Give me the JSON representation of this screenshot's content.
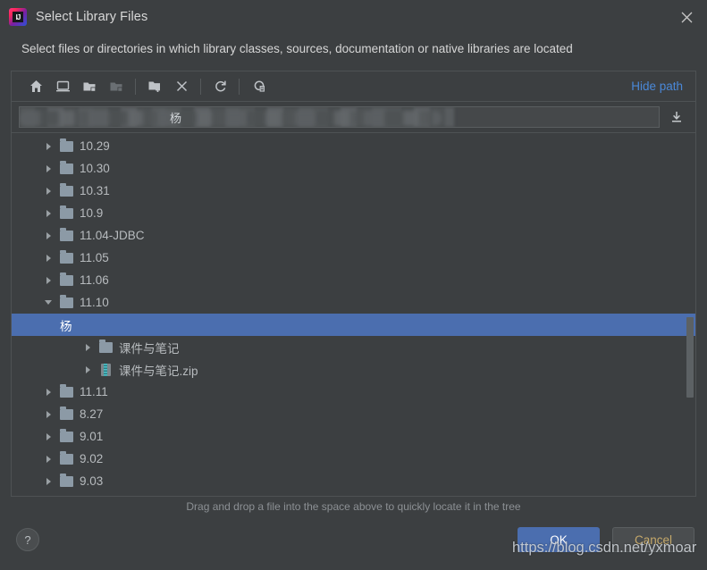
{
  "window": {
    "title": "Select Library Files",
    "app_icon": "intellij-idea-icon",
    "close_label": "✕"
  },
  "subtitle": "Select files or directories in which library classes, sources, documentation or native libraries are located",
  "toolbar": {
    "items": [
      {
        "name": "home-icon",
        "title": "Home"
      },
      {
        "name": "desktop-icon",
        "title": "Desktop"
      },
      {
        "name": "expand-folder-icon",
        "title": "Expand All"
      },
      {
        "name": "collapse-folder-icon",
        "title": "Collapse All"
      },
      {
        "name": "new-folder-icon",
        "title": "New Folder"
      },
      {
        "name": "delete-icon",
        "title": "Delete"
      },
      {
        "name": "refresh-icon",
        "title": "Refresh"
      },
      {
        "name": "show-hidden-files-icon",
        "title": "Show Hidden Files"
      }
    ],
    "hide_path_label": "Hide path"
  },
  "path_field": {
    "value": "杨",
    "placeholder": "",
    "redacted": true,
    "download_icon": "download-icon"
  },
  "tree": {
    "rows": [
      {
        "label": "10.29",
        "depth": 1,
        "icon": "folder-icon",
        "expanded": false,
        "selected": false
      },
      {
        "label": "10.30",
        "depth": 1,
        "icon": "folder-icon",
        "expanded": false,
        "selected": false
      },
      {
        "label": "10.31",
        "depth": 1,
        "icon": "folder-icon",
        "expanded": false,
        "selected": false
      },
      {
        "label": "10.9",
        "depth": 1,
        "icon": "folder-icon",
        "expanded": false,
        "selected": false
      },
      {
        "label": "11.04-JDBC",
        "depth": 1,
        "icon": "folder-icon",
        "expanded": false,
        "selected": false
      },
      {
        "label": "11.05",
        "depth": 1,
        "icon": "folder-icon",
        "expanded": false,
        "selected": false
      },
      {
        "label": "11.06",
        "depth": 1,
        "icon": "folder-icon",
        "expanded": false,
        "selected": false
      },
      {
        "label": "11.10",
        "depth": 1,
        "icon": "folder-icon",
        "expanded": true,
        "selected": false
      },
      {
        "label": "杨",
        "depth": 2,
        "icon": "folder-icon",
        "expanded": true,
        "selected": true,
        "redacted": true
      },
      {
        "label": "课件与笔记",
        "depth": 3,
        "icon": "folder-icon",
        "expanded": false,
        "selected": false
      },
      {
        "label": "课件与笔记.zip",
        "depth": 3,
        "icon": "zip-icon",
        "expanded": false,
        "selected": false
      },
      {
        "label": "11.11",
        "depth": 1,
        "icon": "folder-icon",
        "expanded": false,
        "selected": false
      },
      {
        "label": "8.27",
        "depth": 1,
        "icon": "folder-icon",
        "expanded": false,
        "selected": false
      },
      {
        "label": "9.01",
        "depth": 1,
        "icon": "folder-icon",
        "expanded": false,
        "selected": false
      },
      {
        "label": "9.02",
        "depth": 1,
        "icon": "folder-icon",
        "expanded": false,
        "selected": false
      },
      {
        "label": "9.03",
        "depth": 1,
        "icon": "folder-icon",
        "expanded": false,
        "selected": false
      }
    ]
  },
  "hint": "Drag and drop a file into the space above to quickly locate it in the tree",
  "buttons": {
    "help_label": "?",
    "ok_label": "OK",
    "cancel_label": "Cancel"
  },
  "watermark": "https://blog.csdn.net/yxmoar",
  "colors": {
    "background": "#3c3f41",
    "selection": "#4b6eaf",
    "link": "#4a88d8",
    "text": "#b7bbbe",
    "cancel_text": "#c6a96a",
    "zip_accent": "#4fc3c9"
  }
}
